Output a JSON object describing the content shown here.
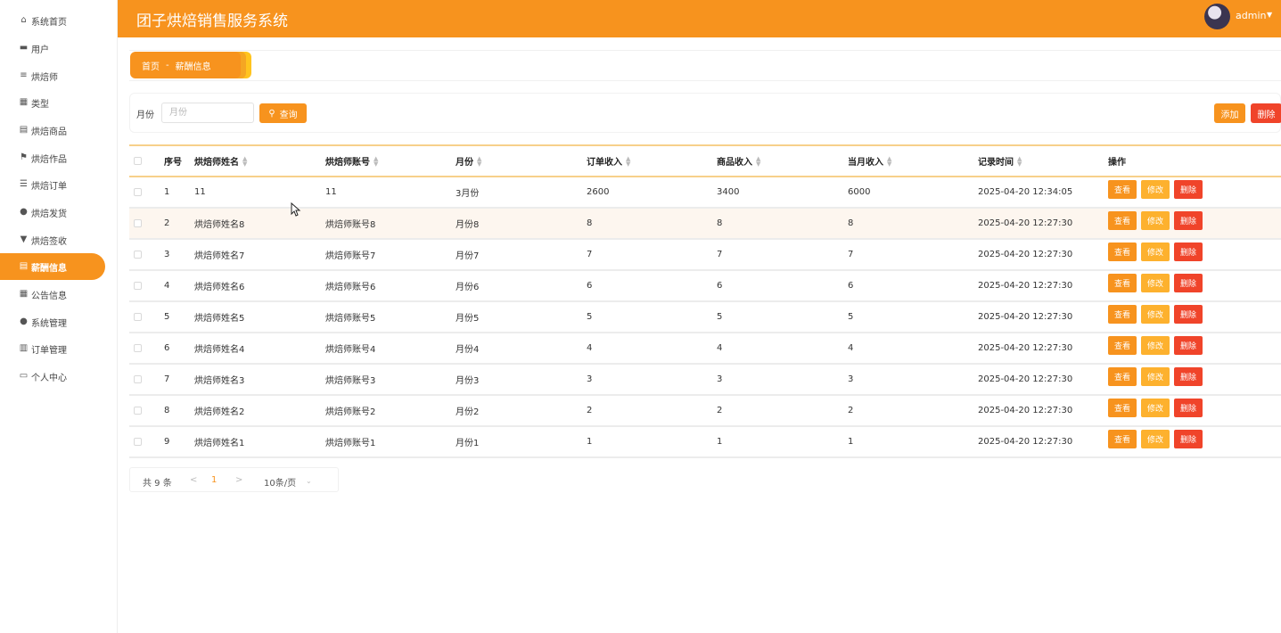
{
  "sidebar": {
    "items": [
      {
        "label": "系统首页",
        "icon": "home-icon",
        "glyph": "⌂"
      },
      {
        "label": "用户",
        "icon": "monitor-icon",
        "glyph": "▬"
      },
      {
        "label": "烘焙师",
        "icon": "list-icon",
        "glyph": "≡"
      },
      {
        "label": "类型",
        "icon": "grid-icon",
        "glyph": "▦"
      },
      {
        "label": "烘焙商品",
        "icon": "clipboard-icon",
        "glyph": "▤"
      },
      {
        "label": "烘焙作品",
        "icon": "flag-icon",
        "glyph": "⚑"
      },
      {
        "label": "烘焙订单",
        "icon": "sliders-icon",
        "glyph": "☰"
      },
      {
        "label": "烘焙发货",
        "icon": "user-icon",
        "glyph": "●"
      },
      {
        "label": "烘焙签收",
        "icon": "stamp-icon",
        "glyph": "▼"
      },
      {
        "label": "薪酬信息",
        "icon": "clipboard-icon",
        "glyph": "▤",
        "active": true
      },
      {
        "label": "公告信息",
        "icon": "grid-icon",
        "glyph": "▦"
      },
      {
        "label": "系统管理",
        "icon": "user-icon",
        "glyph": "●"
      },
      {
        "label": "订单管理",
        "icon": "bars-icon",
        "glyph": "▥"
      },
      {
        "label": "个人中心",
        "icon": "card-icon",
        "glyph": "▭"
      }
    ]
  },
  "header": {
    "title": "团子烘焙销售服务系统",
    "user": "admin"
  },
  "breadcrumb": {
    "home": "首页",
    "separator": "-",
    "current": "薪酬信息"
  },
  "search": {
    "label": "月份",
    "placeholder": "月份",
    "query_label": "查询",
    "add_label": "添加",
    "delete_label": "删除"
  },
  "table": {
    "columns": [
      "序号",
      "烘焙师姓名",
      "烘焙师账号",
      "月份",
      "订单收入",
      "商品收入",
      "当月收入",
      "记录时间",
      "操作"
    ],
    "action_labels": {
      "view": "查看",
      "edit": "修改",
      "delete": "删除"
    },
    "rows": [
      [
        "1",
        "11",
        "11",
        "3月份",
        "2600",
        "3400",
        "6000",
        "2025-04-20 12:34:05"
      ],
      [
        "2",
        "烘焙师姓名8",
        "烘焙师账号8",
        "月份8",
        "8",
        "8",
        "8",
        "2025-04-20 12:27:30"
      ],
      [
        "3",
        "烘焙师姓名7",
        "烘焙师账号7",
        "月份7",
        "7",
        "7",
        "7",
        "2025-04-20 12:27:30"
      ],
      [
        "4",
        "烘焙师姓名6",
        "烘焙师账号6",
        "月份6",
        "6",
        "6",
        "6",
        "2025-04-20 12:27:30"
      ],
      [
        "5",
        "烘焙师姓名5",
        "烘焙师账号5",
        "月份5",
        "5",
        "5",
        "5",
        "2025-04-20 12:27:30"
      ],
      [
        "6",
        "烘焙师姓名4",
        "烘焙师账号4",
        "月份4",
        "4",
        "4",
        "4",
        "2025-04-20 12:27:30"
      ],
      [
        "7",
        "烘焙师姓名3",
        "烘焙师账号3",
        "月份3",
        "3",
        "3",
        "3",
        "2025-04-20 12:27:30"
      ],
      [
        "8",
        "烘焙师姓名2",
        "烘焙师账号2",
        "月份2",
        "2",
        "2",
        "2",
        "2025-04-20 12:27:30"
      ],
      [
        "9",
        "烘焙师姓名1",
        "烘焙师账号1",
        "月份1",
        "1",
        "1",
        "1",
        "2025-04-20 12:27:30"
      ]
    ],
    "highlighted_row": 1
  },
  "pagination": {
    "total": "共 9 条",
    "prev": "<",
    "current_page": "1",
    "next": ">",
    "page_size": "10条/页"
  },
  "colors": {
    "primary": "#f7931e",
    "warning": "#fdb12e",
    "danger": "#f0442a"
  }
}
